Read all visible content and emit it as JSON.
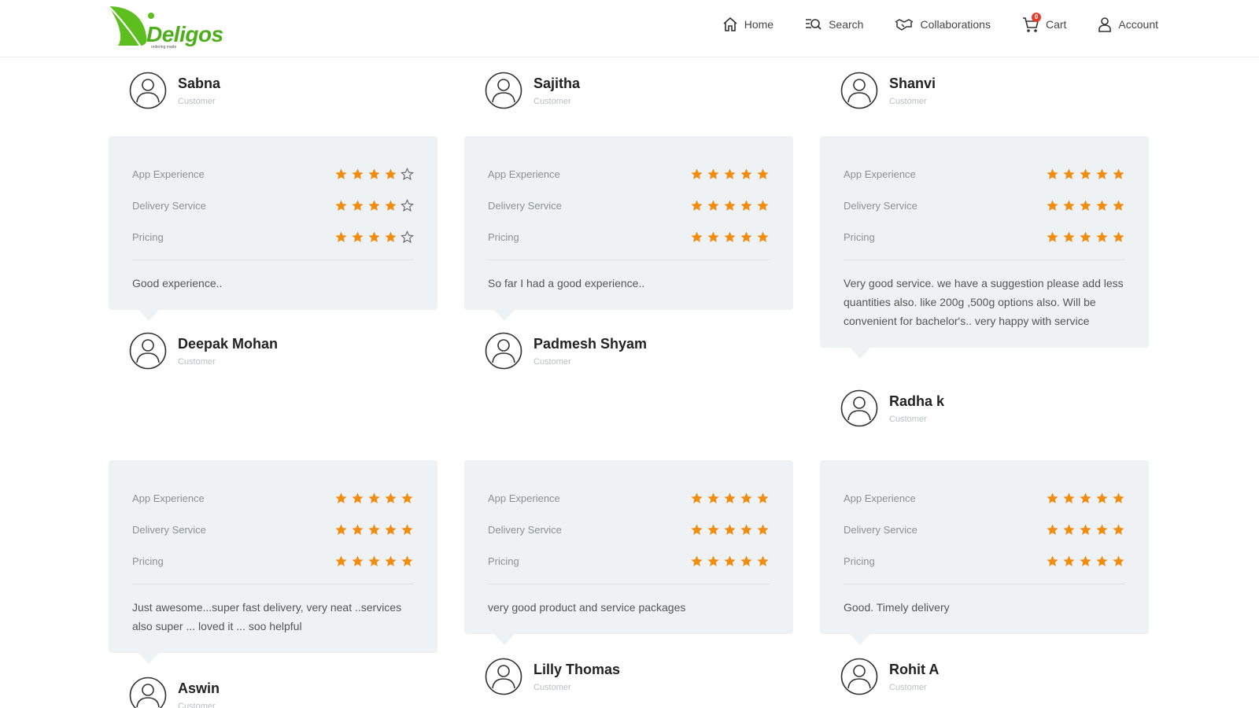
{
  "brand": {
    "name": "Deligos",
    "tagline": "ordering made",
    "color": "#4caf1a"
  },
  "nav": [
    {
      "label": "Home",
      "icon": "home-icon"
    },
    {
      "label": "Search",
      "icon": "search-icon"
    },
    {
      "label": "Collaborations",
      "icon": "handshake-icon"
    },
    {
      "label": "Cart",
      "icon": "cart-icon",
      "badge": "0"
    },
    {
      "label": "Account",
      "icon": "user-icon"
    }
  ],
  "colors": {
    "star": "#f28c0f",
    "card": "#eef2f5"
  },
  "top_authors": [
    {
      "name": "Sabna",
      "role": "Customer"
    },
    {
      "name": "Sajitha",
      "role": "Customer"
    },
    {
      "name": "Shanvi",
      "role": "Customer"
    }
  ],
  "reviews": [
    {
      "ratings": [
        {
          "label": "App Experience",
          "stars": 4
        },
        {
          "label": "Delivery Service",
          "stars": 4
        },
        {
          "label": "Pricing",
          "stars": 4
        }
      ],
      "comment": "Good experience..",
      "author": "Deepak Mohan",
      "role": "Customer"
    },
    {
      "ratings": [
        {
          "label": "App Experience",
          "stars": 5
        },
        {
          "label": "Delivery Service",
          "stars": 5
        },
        {
          "label": "Pricing",
          "stars": 5
        }
      ],
      "comment": "So far I had a good experience..",
      "author": "Padmesh Shyam",
      "role": "Customer"
    },
    {
      "ratings": [
        {
          "label": "App Experience",
          "stars": 5
        },
        {
          "label": "Delivery Service",
          "stars": 5
        },
        {
          "label": "Pricing",
          "stars": 5
        }
      ],
      "comment": "Very good service. we have a suggestion please add less quantities also. like 200g ,500g options also. Will be convenient for bachelor's.. very happy with service",
      "author": "Radha k",
      "role": "Customer"
    },
    {
      "ratings": [
        {
          "label": "App Experience",
          "stars": 5
        },
        {
          "label": "Delivery Service",
          "stars": 5
        },
        {
          "label": "Pricing",
          "stars": 5
        }
      ],
      "comment": "Just awesome...super fast delivery, very neat ..services also super ... loved it ... soo helpful",
      "author": "Aswin",
      "role": "Customer"
    },
    {
      "ratings": [
        {
          "label": "App Experience",
          "stars": 5
        },
        {
          "label": "Delivery Service",
          "stars": 5
        },
        {
          "label": "Pricing",
          "stars": 5
        }
      ],
      "comment": "very good product and service packages",
      "author": "Lilly Thomas",
      "role": "Customer"
    },
    {
      "ratings": [
        {
          "label": "App Experience",
          "stars": 5
        },
        {
          "label": "Delivery Service",
          "stars": 5
        },
        {
          "label": "Pricing",
          "stars": 5
        }
      ],
      "comment": "Good. Timely delivery",
      "author": "Rohit A",
      "role": "Customer"
    }
  ]
}
